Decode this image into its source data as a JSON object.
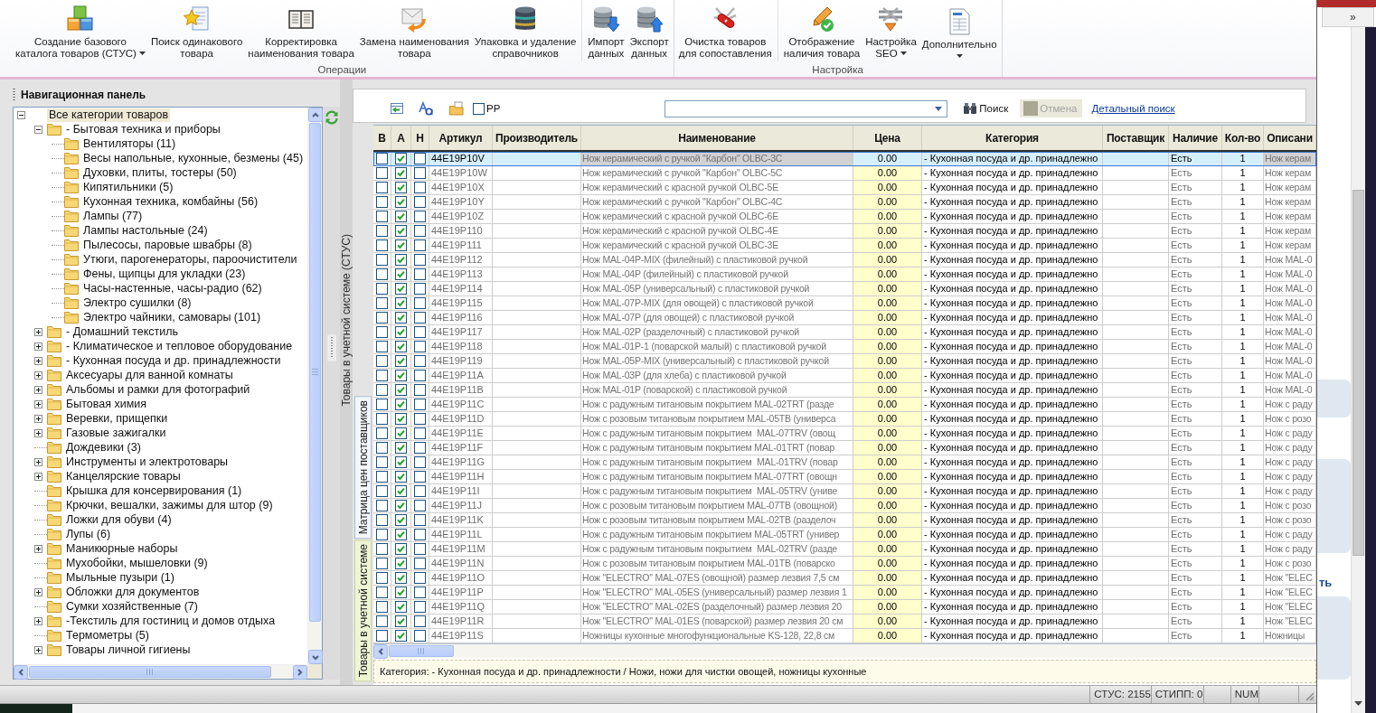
{
  "ribbon": {
    "groups": [
      {
        "label": "Операции",
        "sections": [
          [
            {
              "label": "Создание базового\nкаталога товаров (СТУС)",
              "dropdown": true
            },
            {
              "label": "Поиск одинакового\nтовара",
              "dropdown": false
            },
            {
              "label": "Корректировка\nнаименования товара",
              "dropdown": false
            },
            {
              "label": "Замена наименования\nтовара",
              "dropdown": false
            },
            {
              "label": "Упаковка и удаление\nсправочников",
              "dropdown": false
            }
          ],
          [
            {
              "label": "Импорт\nданных",
              "dropdown": false
            },
            {
              "label": "Экспорт\nданных",
              "dropdown": false
            }
          ]
        ]
      },
      {
        "label": "Настройка",
        "sections": [
          [
            {
              "label": "Очистка товаров\nдля сопоставления",
              "dropdown": false
            }
          ],
          [
            {
              "label": "Отображение\nналичия товара",
              "dropdown": false
            },
            {
              "label": "Настройка\nSEO",
              "dropdown": true
            },
            {
              "label": "Дополнительно",
              "dropdown": true
            }
          ]
        ]
      }
    ]
  },
  "navigation_panel": {
    "title": "Навигационная панель",
    "tree": [
      {
        "label": "Все категории товаров",
        "selected": true,
        "expanded": true,
        "children": [
          {
            "label": "- Бытовая техника и приборы",
            "selected": false,
            "expanded": true,
            "children": [
              {
                "label": "Вентиляторы (11)",
                "selected": false
              },
              {
                "label": "Весы напольные, кухонные, безмены (45)",
                "selected": false
              },
              {
                "label": "Духовки, плиты, тостеры (50)",
                "selected": false
              },
              {
                "label": "Кипятильники (5)",
                "selected": false
              },
              {
                "label": "Кухонная техника, комбайны (56)",
                "selected": false
              },
              {
                "label": "Лампы (77)",
                "selected": false
              },
              {
                "label": "Лампы настольные (24)",
                "selected": false
              },
              {
                "label": "Пылесосы, паровые швабры (8)",
                "selected": false
              },
              {
                "label": "Утюги, парогенераторы, пароочистители",
                "selected": false
              },
              {
                "label": "Фены, щипцы для укладки (23)",
                "selected": false
              },
              {
                "label": "Часы-настенные, часы-радио (62)",
                "selected": false
              },
              {
                "label": "Электро сушилки (8)",
                "selected": false
              },
              {
                "label": "Электро чайники, самовары (101)",
                "selected": false
              }
            ]
          },
          {
            "label": "- Домашний текстиль",
            "selected": false,
            "expanded": false
          },
          {
            "label": "- Климатическое и тепловое оборудование",
            "selected": false,
            "expanded": false
          },
          {
            "label": "- Кухонная посуда и др. принадлежности",
            "selected": false,
            "expanded": false
          },
          {
            "label": "Аксесуары для ванной комнаты",
            "selected": false,
            "expanded": false
          },
          {
            "label": "Альбомы и рамки для фотографий",
            "selected": false,
            "expanded": false
          },
          {
            "label": "Бытовая химия",
            "selected": false,
            "expanded": false
          },
          {
            "label": "Веревки, прищепки",
            "selected": false,
            "expanded": false
          },
          {
            "label": "Газовые зажигалки",
            "selected": false,
            "expanded": false
          },
          {
            "label": "Дождевики (3)",
            "selected": false
          },
          {
            "label": "Инструменты и электротовары",
            "selected": false,
            "expanded": false
          },
          {
            "label": "Канцелярские товары",
            "selected": false,
            "expanded": false
          },
          {
            "label": "Крышка для консервирования (1)",
            "selected": false
          },
          {
            "label": "Крючки, вешалки, зажимы для штор (9)",
            "selected": false
          },
          {
            "label": "Ложки для обуви (4)",
            "selected": false
          },
          {
            "label": "Лупы (6)",
            "selected": false
          },
          {
            "label": "Маникюрные наборы",
            "selected": false,
            "expanded": false
          },
          {
            "label": "Мухобойки, мышеловки (9)",
            "selected": false
          },
          {
            "label": "Мыльные пузыри (1)",
            "selected": false
          },
          {
            "label": "Обложки для документов",
            "selected": false,
            "expanded": false
          },
          {
            "label": "Сумки хозяйственные (7)",
            "selected": false
          },
          {
            "label": "-Текстиль для гостиниц и домов отдыха",
            "selected": false,
            "expanded": false
          },
          {
            "label": "Термометры (5)",
            "selected": false
          },
          {
            "label": "Товары личной гигиены",
            "selected": false,
            "expanded": false
          }
        ]
      }
    ]
  },
  "side_panel": {
    "title": "Товары в учетной системе (СТУС)"
  },
  "tabs": [
    {
      "label": "Матрица цен поставщиков",
      "selected": true
    },
    {
      "label": "Товары в учетной системе",
      "selected": false
    }
  ],
  "toolbar": {
    "pp_checkbox": {
      "label": "PP",
      "checked": false
    },
    "search_button": "Поиск",
    "cancel_button": {
      "label": "Отмена",
      "disabled": true
    },
    "link": "Детальный поиск"
  },
  "grid": {
    "columns": [
      "В",
      "А",
      "Н",
      "Артикул",
      "Производитель",
      "Наименование",
      "Цена",
      "Категория",
      "Поставщик",
      "Наличие",
      "Кол-во",
      "Описани"
    ],
    "rows": [
      {
        "selected": true,
        "checks": [
          false,
          true,
          false
        ],
        "article": "44E19P10V",
        "name": "Нож керамический с ручкой \"Карбон\" OLBC-3C",
        "price": "0.00",
        "category": "- Кухонная посуда и др. принадлежно",
        "availability": "Есть",
        "quantity": "1",
        "description": "Нож керам"
      },
      {
        "selected": false,
        "checks": [
          false,
          true,
          false
        ],
        "article": "44E19P10W",
        "name": "Нож керамический с ручкой \"Карбон\" OLBC-5C",
        "price": "0.00",
        "category": "- Кухонная посуда и др. принадлежно",
        "availability": "Есть",
        "quantity": "1",
        "description": "Нож керам"
      },
      {
        "selected": false,
        "checks": [
          false,
          true,
          false
        ],
        "article": "44E19P10X",
        "name": "Нож керамический с красной ручкой OLBC-5E",
        "price": "0.00",
        "category": "- Кухонная посуда и др. принадлежно",
        "availability": "Есть",
        "quantity": "1",
        "description": "Нож керам"
      },
      {
        "selected": false,
        "checks": [
          false,
          true,
          false
        ],
        "article": "44E19P10Y",
        "name": "Нож керамический с ручкой \"Карбон\" OLBC-4C",
        "price": "0.00",
        "category": "- Кухонная посуда и др. принадлежно",
        "availability": "Есть",
        "quantity": "1",
        "description": "Нож керам"
      },
      {
        "selected": false,
        "checks": [
          false,
          true,
          false
        ],
        "article": "44E19P10Z",
        "name": "Нож керамический с красной ручкой OLBC-6E",
        "price": "0.00",
        "category": "- Кухонная посуда и др. принадлежно",
        "availability": "Есть",
        "quantity": "1",
        "description": "Нож керам"
      },
      {
        "selected": false,
        "checks": [
          false,
          true,
          false
        ],
        "article": "44E19P110",
        "name": "Нож керамический с красной ручкой OLBC-4E",
        "price": "0.00",
        "category": "- Кухонная посуда и др. принадлежно",
        "availability": "Есть",
        "quantity": "1",
        "description": "Нож керам"
      },
      {
        "selected": false,
        "checks": [
          false,
          true,
          false
        ],
        "article": "44E19P111",
        "name": "Нож керамический с красной ручкой OLBC-3E",
        "price": "0.00",
        "category": "- Кухонная посуда и др. принадлежно",
        "availability": "Есть",
        "quantity": "1",
        "description": "Нож керам"
      },
      {
        "selected": false,
        "checks": [
          false,
          true,
          false
        ],
        "article": "44E19P112",
        "name": "Нож MAL-04P-MIX (филейный) с пластиковой ручкой",
        "price": "0.00",
        "category": "- Кухонная посуда и др. принадлежно",
        "availability": "Есть",
        "quantity": "1",
        "description": "Нож MAL-0"
      },
      {
        "selected": false,
        "checks": [
          false,
          true,
          false
        ],
        "article": "44E19P113",
        "name": "Нож MAL-04P (филейный) с пластиковой ручкой",
        "price": "0.00",
        "category": "- Кухонная посуда и др. принадлежно",
        "availability": "Есть",
        "quantity": "1",
        "description": "Нож MAL-0"
      },
      {
        "selected": false,
        "checks": [
          false,
          true,
          false
        ],
        "article": "44E19P114",
        "name": "Нож MAL-05P (универсальный) с пластиковой ручкой",
        "price": "0.00",
        "category": "- Кухонная посуда и др. принадлежно",
        "availability": "Есть",
        "quantity": "1",
        "description": "Нож MAL-0"
      },
      {
        "selected": false,
        "checks": [
          false,
          true,
          false
        ],
        "article": "44E19P115",
        "name": "Нож MAL-07P-MIX (для овощей) с пластиковой ручкой",
        "price": "0.00",
        "category": "- Кухонная посуда и др. принадлежно",
        "availability": "Есть",
        "quantity": "1",
        "description": "Нож MAL-0"
      },
      {
        "selected": false,
        "checks": [
          false,
          true,
          false
        ],
        "article": "44E19P116",
        "name": "Нож MAL-07P (для овощей) с пластиковой ручкой",
        "price": "0.00",
        "category": "- Кухонная посуда и др. принадлежно",
        "availability": "Есть",
        "quantity": "1",
        "description": "Нож MAL-0"
      },
      {
        "selected": false,
        "checks": [
          false,
          true,
          false
        ],
        "article": "44E19P117",
        "name": "Нож MAL-02P (разделочный) с пластиковой ручкой",
        "price": "0.00",
        "category": "- Кухонная посуда и др. принадлежно",
        "availability": "Есть",
        "quantity": "1",
        "description": "Нож MAL-0"
      },
      {
        "selected": false,
        "checks": [
          false,
          true,
          false
        ],
        "article": "44E19P118",
        "name": "Нож MAL-01P-1 (поварской малый) с пластиковой ручкой",
        "price": "0.00",
        "category": "- Кухонная посуда и др. принадлежно",
        "availability": "Есть",
        "quantity": "1",
        "description": "Нож MAL-0"
      },
      {
        "selected": false,
        "checks": [
          false,
          true,
          false
        ],
        "article": "44E19P119",
        "name": "Нож MAL-05P-MIX (универсальный) с пластиковой ручкой",
        "price": "0.00",
        "category": "- Кухонная посуда и др. принадлежно",
        "availability": "Есть",
        "quantity": "1",
        "description": "Нож MAL-0"
      },
      {
        "selected": false,
        "checks": [
          false,
          true,
          false
        ],
        "article": "44E19P11A",
        "name": "Нож MAL-03P (для хлеба) с пластиковой ручкой",
        "price": "0.00",
        "category": "- Кухонная посуда и др. принадлежно",
        "availability": "Есть",
        "quantity": "1",
        "description": "Нож MAL-0"
      },
      {
        "selected": false,
        "checks": [
          false,
          true,
          false
        ],
        "article": "44E19P11B",
        "name": "Нож MAL-01P (поварской) с пластиковой ручкой",
        "price": "0.00",
        "category": "- Кухонная посуда и др. принадлежно",
        "availability": "Есть",
        "quantity": "1",
        "description": "Нож MAL-0"
      },
      {
        "selected": false,
        "checks": [
          false,
          true,
          false
        ],
        "article": "44E19P11C",
        "name": "Нож с радужным титановым покрытием MAL-02TRT (разде",
        "price": "0.00",
        "category": "- Кухонная посуда и др. принадлежно",
        "availability": "Есть",
        "quantity": "1",
        "description": "Нож с раду"
      },
      {
        "selected": false,
        "checks": [
          false,
          true,
          false
        ],
        "article": "44E19P11D",
        "name": "Нож с розовым титановым покрытием MAL-05TB (универса",
        "price": "0.00",
        "category": "- Кухонная посуда и др. принадлежно",
        "availability": "Есть",
        "quantity": "1",
        "description": "Нож с розо"
      },
      {
        "selected": false,
        "checks": [
          false,
          true,
          false
        ],
        "article": "44E19P11E",
        "name": "Нож с радужным титановым покрытием  MAL-07TRV (овощ",
        "price": "0.00",
        "category": "- Кухонная посуда и др. принадлежно",
        "availability": "Есть",
        "quantity": "1",
        "description": "Нож с раду"
      },
      {
        "selected": false,
        "checks": [
          false,
          true,
          false
        ],
        "article": "44E19P11F",
        "name": "Нож с радужным титановым покрытием MAL-01TRT (повар",
        "price": "0.00",
        "category": "- Кухонная посуда и др. принадлежно",
        "availability": "Есть",
        "quantity": "1",
        "description": "Нож с раду"
      },
      {
        "selected": false,
        "checks": [
          false,
          true,
          false
        ],
        "article": "44E19P11G",
        "name": "Нож с радужным титановым покрытием  MAL-01TRV (повар",
        "price": "0.00",
        "category": "- Кухонная посуда и др. принадлежно",
        "availability": "Есть",
        "quantity": "1",
        "description": "Нож с раду"
      },
      {
        "selected": false,
        "checks": [
          false,
          true,
          false
        ],
        "article": "44E19P11H",
        "name": "Нож с радужным титановым покрытием MAL-07TRT (овощн",
        "price": "0.00",
        "category": "- Кухонная посуда и др. принадлежно",
        "availability": "Есть",
        "quantity": "1",
        "description": "Нож с раду"
      },
      {
        "selected": false,
        "checks": [
          false,
          true,
          false
        ],
        "article": "44E19P11I",
        "name": "Нож с радужным титановым покрытием  MAL-05TRV (униве",
        "price": "0.00",
        "category": "- Кухонная посуда и др. принадлежно",
        "availability": "Есть",
        "quantity": "1",
        "description": "Нож с раду"
      },
      {
        "selected": false,
        "checks": [
          false,
          true,
          false
        ],
        "article": "44E19P11J",
        "name": "Нож с розовым титановым покрытием MAL-07TB (овощной)",
        "price": "0.00",
        "category": "- Кухонная посуда и др. принадлежно",
        "availability": "Есть",
        "quantity": "1",
        "description": "Нож с розо"
      },
      {
        "selected": false,
        "checks": [
          false,
          true,
          false
        ],
        "article": "44E19P11K",
        "name": "Нож с розовым титановым покрытием MAL-02TB (разделоч",
        "price": "0.00",
        "category": "- Кухонная посуда и др. принадлежно",
        "availability": "Есть",
        "quantity": "1",
        "description": "Нож с розо"
      },
      {
        "selected": false,
        "checks": [
          false,
          true,
          false
        ],
        "article": "44E19P11L",
        "name": "Нож с радужным титановым покрытием MAL-05TRT (универ",
        "price": "0.00",
        "category": "- Кухонная посуда и др. принадлежно",
        "availability": "Есть",
        "quantity": "1",
        "description": "Нож с раду"
      },
      {
        "selected": false,
        "checks": [
          false,
          true,
          false
        ],
        "article": "44E19P11M",
        "name": "Нож с радужным титановым покрытием  MAL-02TRV (разде",
        "price": "0.00",
        "category": "- Кухонная посуда и др. принадлежно",
        "availability": "Есть",
        "quantity": "1",
        "description": "Нож с раду"
      },
      {
        "selected": false,
        "checks": [
          false,
          true,
          false
        ],
        "article": "44E19P11N",
        "name": "Нож с розовым титановым покрытием MAL-01TB (поварско",
        "price": "0.00",
        "category": "- Кухонная посуда и др. принадлежно",
        "availability": "Есть",
        "quantity": "1",
        "description": "Нож с розо"
      },
      {
        "selected": false,
        "checks": [
          false,
          true,
          false
        ],
        "article": "44E19P11O",
        "name": "Нож \"ELECTRO\" MAL-07ES (овощной) размер лезвия 7,5 см",
        "price": "0.00",
        "category": "- Кухонная посуда и др. принадлежно",
        "availability": "Есть",
        "quantity": "1",
        "description": "Нож \"ELEC"
      },
      {
        "selected": false,
        "checks": [
          false,
          true,
          false
        ],
        "article": "44E19P11P",
        "name": "Нож \"ELECTRO\" MAL-05ES (универсальный) размер лезвия 1",
        "price": "0.00",
        "category": "- Кухонная посуда и др. принадлежно",
        "availability": "Есть",
        "quantity": "1",
        "description": "Нож \"ELEC"
      },
      {
        "selected": false,
        "checks": [
          false,
          true,
          false
        ],
        "article": "44E19P11Q",
        "name": "Нож \"ELECTRO\" MAL-02ES (разделочный) размер лезвия 20",
        "price": "0.00",
        "category": "- Кухонная посуда и др. принадлежно",
        "availability": "Есть",
        "quantity": "1",
        "description": "Нож \"ELEC"
      },
      {
        "selected": false,
        "checks": [
          false,
          true,
          false
        ],
        "article": "44E19P11R",
        "name": "Нож \"ELECTRO\" MAL-01ES (поварской) размер лезвия 20 см",
        "price": "0.00",
        "category": "- Кухонная посуда и др. принадлежно",
        "availability": "Есть",
        "quantity": "1",
        "description": "Нож \"ELEC"
      },
      {
        "selected": false,
        "checks": [
          false,
          true,
          false
        ],
        "article": "44E19P11S",
        "name": "Ножницы кухонные многофункциональные KS-128, 22,8 см",
        "price": "0.00",
        "category": "- Кухонная посуда и др. принадлежно",
        "availability": "Есть",
        "quantity": "1",
        "description": "Ножницы"
      }
    ]
  },
  "category_path": "Категория: - Кухонная посуда и др. принадлежности / Ножи, ножи для чистки овощей, ножницы кухонные",
  "status_bar": {
    "panels": [
      "СТУС: 2155",
      "СТИПП: 0",
      "NUM"
    ]
  },
  "background_window": {
    "button": "»",
    "link_fragment": "ть"
  }
}
